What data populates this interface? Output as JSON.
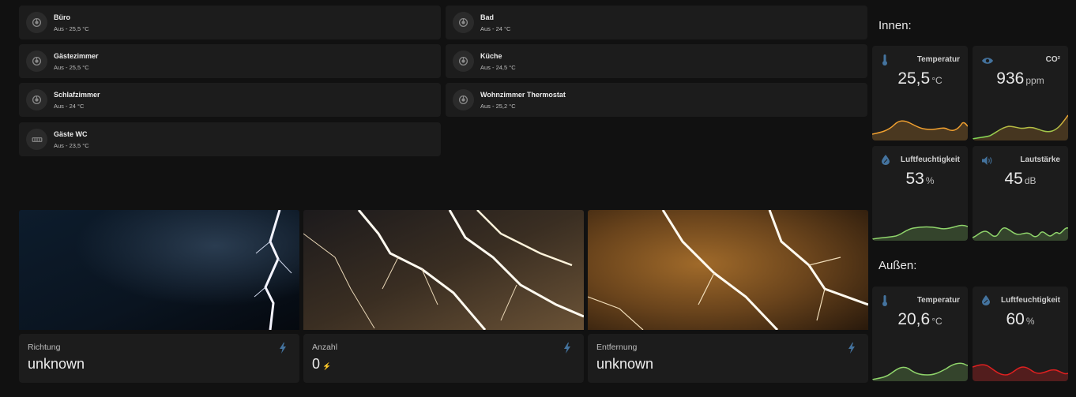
{
  "thermostats": [
    {
      "name": "Büro",
      "state": "Aus - 25,5 °C",
      "icon": "thermostat-icon"
    },
    {
      "name": "Bad",
      "state": "Aus - 24 °C",
      "icon": "thermostat-icon"
    },
    {
      "name": "Gästezimmer",
      "state": "Aus - 25,5 °C",
      "icon": "thermostat-icon"
    },
    {
      "name": "Küche",
      "state": "Aus - 24,5 °C",
      "icon": "thermostat-icon"
    },
    {
      "name": "Schlafzimmer",
      "state": "Aus - 24 °C",
      "icon": "thermostat-icon"
    },
    {
      "name": "Wohnzimmer Thermostat",
      "state": "Aus - 25,2 °C",
      "icon": "thermostat-icon"
    },
    {
      "name": "Gäste WC",
      "state": "Aus - 23,5 °C",
      "icon": "radiator-icon"
    }
  ],
  "lightning": [
    {
      "label": "Richtung",
      "value": "unknown",
      "unit": "",
      "icon": "flash-icon"
    },
    {
      "label": "Anzahl",
      "value": "0",
      "unit": "⚡",
      "icon": "flash-icon"
    },
    {
      "label": "Entfernung",
      "value": "unknown",
      "unit": "",
      "icon": "flash-icon"
    }
  ],
  "innen": {
    "title": "Innen:",
    "sensors": [
      {
        "name": "Temperatur",
        "value": "25,5",
        "unit": "°C",
        "icon": "thermometer-icon",
        "colors": [
          "#f0a030",
          "#e07a20"
        ]
      },
      {
        "name": "CO²",
        "value": "936",
        "unit": "ppm",
        "icon": "eye-icon",
        "colors": [
          "#7ed957",
          "#f0a030"
        ]
      },
      {
        "name": "Luftfeuchtigkeit",
        "value": "53",
        "unit": "%",
        "icon": "water-percent-icon",
        "colors": [
          "#8fd46b",
          "#7ac05a"
        ]
      },
      {
        "name": "Lautstärke",
        "value": "45",
        "unit": "dB",
        "icon": "volume-icon",
        "colors": [
          "#8fd46b",
          "#7ac05a"
        ]
      }
    ]
  },
  "aussen": {
    "title": "Außen:",
    "sensors": [
      {
        "name": "Temperatur",
        "value": "20,6",
        "unit": "°C",
        "icon": "thermometer-icon",
        "colors": [
          "#8fd46b",
          "#7ac05a"
        ]
      },
      {
        "name": "Luftfeuchtigkeit",
        "value": "60",
        "unit": "%",
        "icon": "water-percent-icon",
        "colors": [
          "#e02020",
          "#c01818"
        ]
      }
    ]
  },
  "accent_color": "#44739e"
}
